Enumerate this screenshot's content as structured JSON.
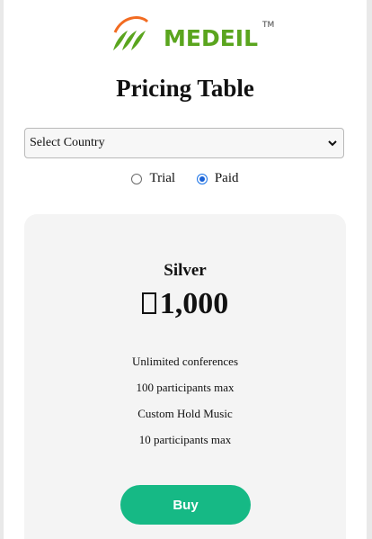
{
  "brand": {
    "logo_text": "MEDEIL",
    "trademark": "TM"
  },
  "page_title": "Pricing Table",
  "country_select": {
    "selected": "Select Country"
  },
  "plan_type": {
    "options": [
      {
        "label": "Trial",
        "checked": false
      },
      {
        "label": "Paid",
        "checked": true
      }
    ]
  },
  "plan": {
    "name": "Silver",
    "price": "1,000",
    "features": [
      "Unlimited conferences",
      "100 participants max",
      "Custom Hold Music",
      "10 participants max"
    ],
    "buy_label": "Buy"
  },
  "colors": {
    "brand_green": "#5aa51e",
    "brand_orange": "#f26b21",
    "buy_button": "#16b985",
    "card_bg": "#f4f4f4",
    "radio_accent": "#1a62d6"
  }
}
